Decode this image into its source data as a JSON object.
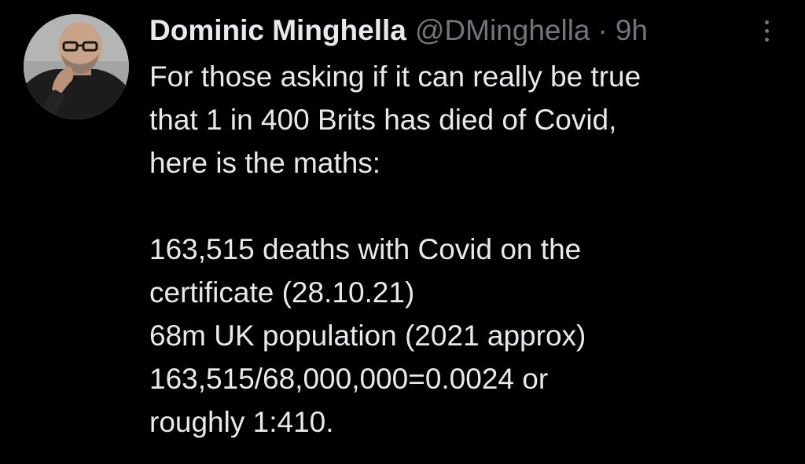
{
  "tweet": {
    "author": {
      "display_name": "Dominic Minghella",
      "handle": "@DMinghella",
      "separator": "·",
      "time": "9h"
    },
    "more_icon": "more-vertical-icon",
    "paragraph1": [
      "For those asking if it can really be true",
      "that 1 in 400 Brits has died of Covid,",
      "here is the maths:"
    ],
    "paragraph2": [
      "163,515 deaths with Covid on the",
      "certificate (28.10.21)",
      "68m UK population (2021 approx)",
      "163,515/68,000,000=0.0024 or",
      "roughly 1:410."
    ]
  },
  "colors": {
    "background": "#000000",
    "primary_text": "#e7e9ea",
    "secondary_text": "#71767b"
  }
}
